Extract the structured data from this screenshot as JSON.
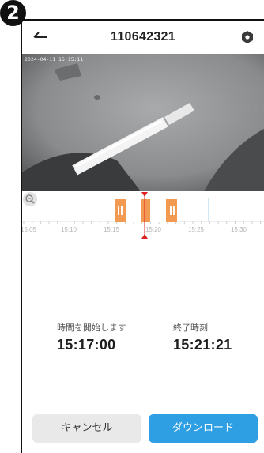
{
  "step_badge": "2",
  "header": {
    "title": "110642321",
    "back_icon": "back-arrow-icon",
    "settings_icon": "hexagon-settings-icon"
  },
  "video": {
    "timestamp": "2024-04-11  15:15:11"
  },
  "timeline": {
    "ticks": [
      "15:05",
      "15:10",
      "15:15",
      "15:20",
      "15:25",
      "15:30"
    ],
    "zoom_icon": "zoom-icon",
    "selection_color": "#f39a52",
    "marker_color": "#e02020"
  },
  "range": {
    "start_label": "時間を開始します",
    "start_value": "15:17:00",
    "end_label": "終了時刻",
    "end_value": "15:21:21"
  },
  "buttons": {
    "cancel": "キャンセル",
    "download": "ダウンロード"
  },
  "colors": {
    "accent": "#2f9fe3",
    "cancel_bg": "#e9e9e9"
  }
}
